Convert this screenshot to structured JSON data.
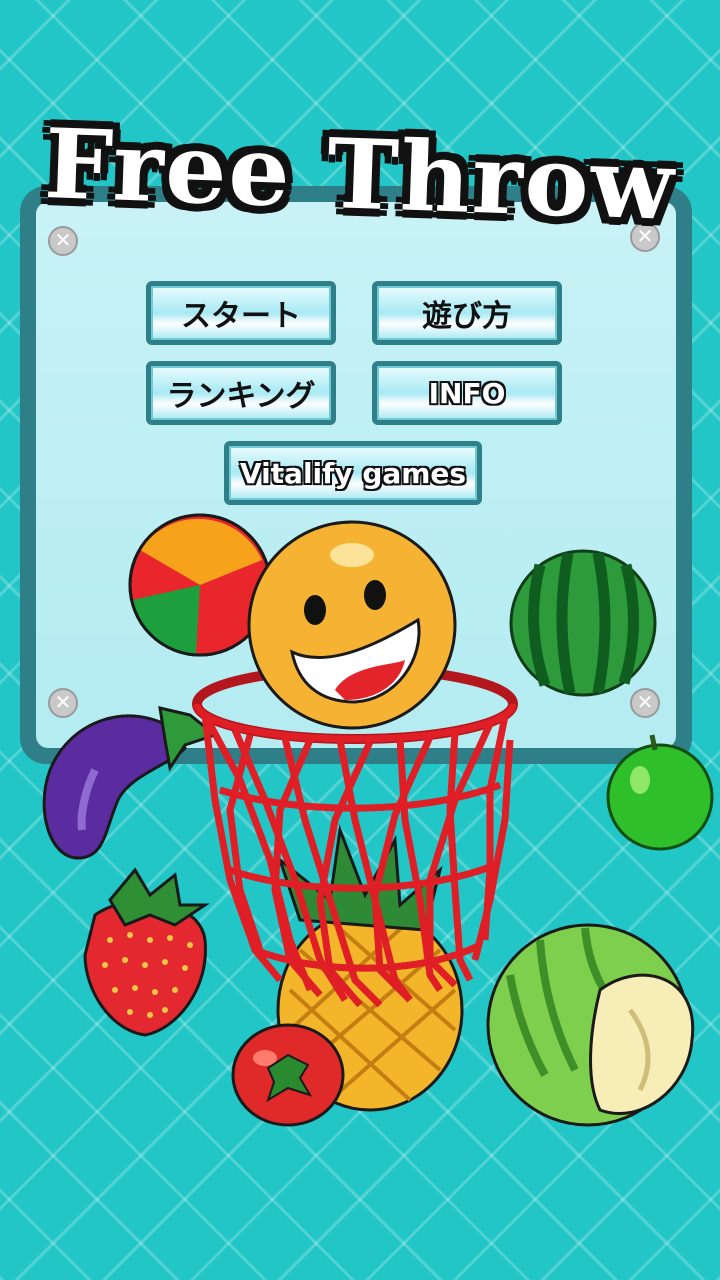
{
  "title": "Free Throw",
  "menu": {
    "start": "スタート",
    "how_to_play": "遊び方",
    "ranking": "ランキング",
    "info": "INFO",
    "vitalify": "Vitalify games"
  },
  "colors": {
    "background": "#22c6c6",
    "board_frame": "#2f7f88",
    "board_fill": "#bfeff4",
    "hoop_red": "#e01e26"
  }
}
